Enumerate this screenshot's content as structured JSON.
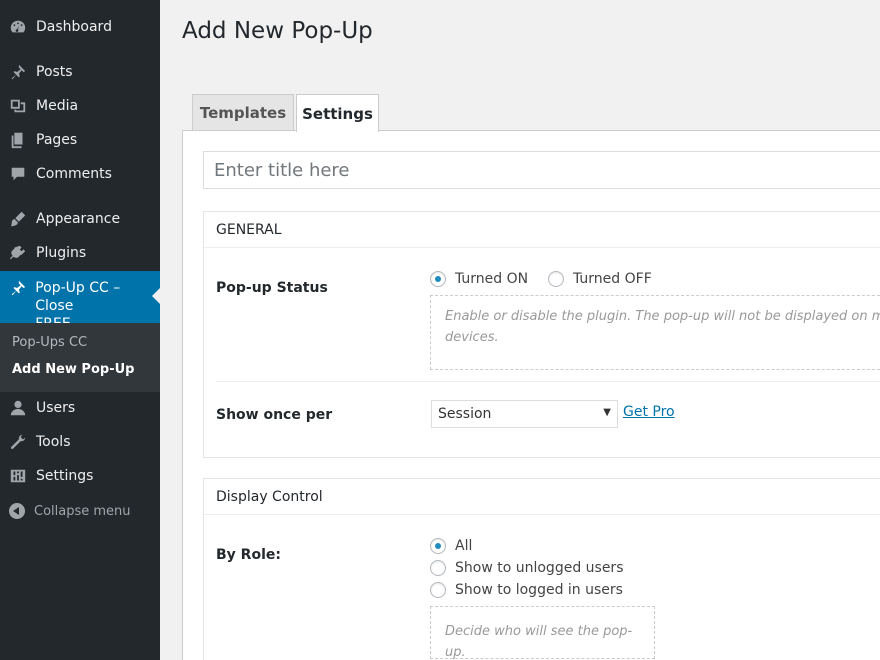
{
  "sidebar": {
    "items": [
      {
        "label": "Dashboard",
        "icon": "dashboard-icon"
      },
      {
        "label": "Posts",
        "icon": "pin-icon"
      },
      {
        "label": "Media",
        "icon": "media-icon"
      },
      {
        "label": "Pages",
        "icon": "pages-icon"
      },
      {
        "label": "Comments",
        "icon": "comment-icon"
      },
      {
        "label": "Appearance",
        "icon": "brush-icon"
      },
      {
        "label": "Plugins",
        "icon": "plug-icon"
      },
      {
        "label": "Pop-Up CC – Close FREE",
        "icon": "pin-icon"
      },
      {
        "label": "Users",
        "icon": "user-icon"
      },
      {
        "label": "Tools",
        "icon": "wrench-icon"
      },
      {
        "label": "Settings",
        "icon": "settings-icon"
      }
    ],
    "active_label_line1": "Pop-Up CC – Close",
    "active_label_line2": "FREE",
    "submenu": [
      {
        "label": "Pop-Ups CC"
      },
      {
        "label": "Add New Pop-Up"
      }
    ],
    "collapse_label": "Collapse menu"
  },
  "page": {
    "title": "Add New Pop-Up",
    "tabs": [
      {
        "label": "Templates"
      },
      {
        "label": "Settings"
      }
    ],
    "title_placeholder": "Enter title here"
  },
  "general": {
    "heading": "GENERAL",
    "status_label": "Pop-up Status",
    "status_on": "Turned ON",
    "status_off": "Turned OFF",
    "status_selected": "Turned ON",
    "status_desc_line1": "Enable or disable the plugin. The pop-up will not be displayed on mobi",
    "status_desc_line2": "devices.",
    "show_once_label": "Show once per",
    "show_once_value": "Session",
    "get_pro": "Get Pro"
  },
  "display": {
    "heading": "Display Control",
    "role_label": "By Role:",
    "roles": [
      "All",
      "Show to unlogged users",
      "Show to logged in users"
    ],
    "role_selected": "All",
    "role_desc": "Decide who will see the pop-up."
  },
  "colors": {
    "sidebar": "#23282d",
    "accent": "#0073aa",
    "radio_dot": "#1e8cbe"
  }
}
